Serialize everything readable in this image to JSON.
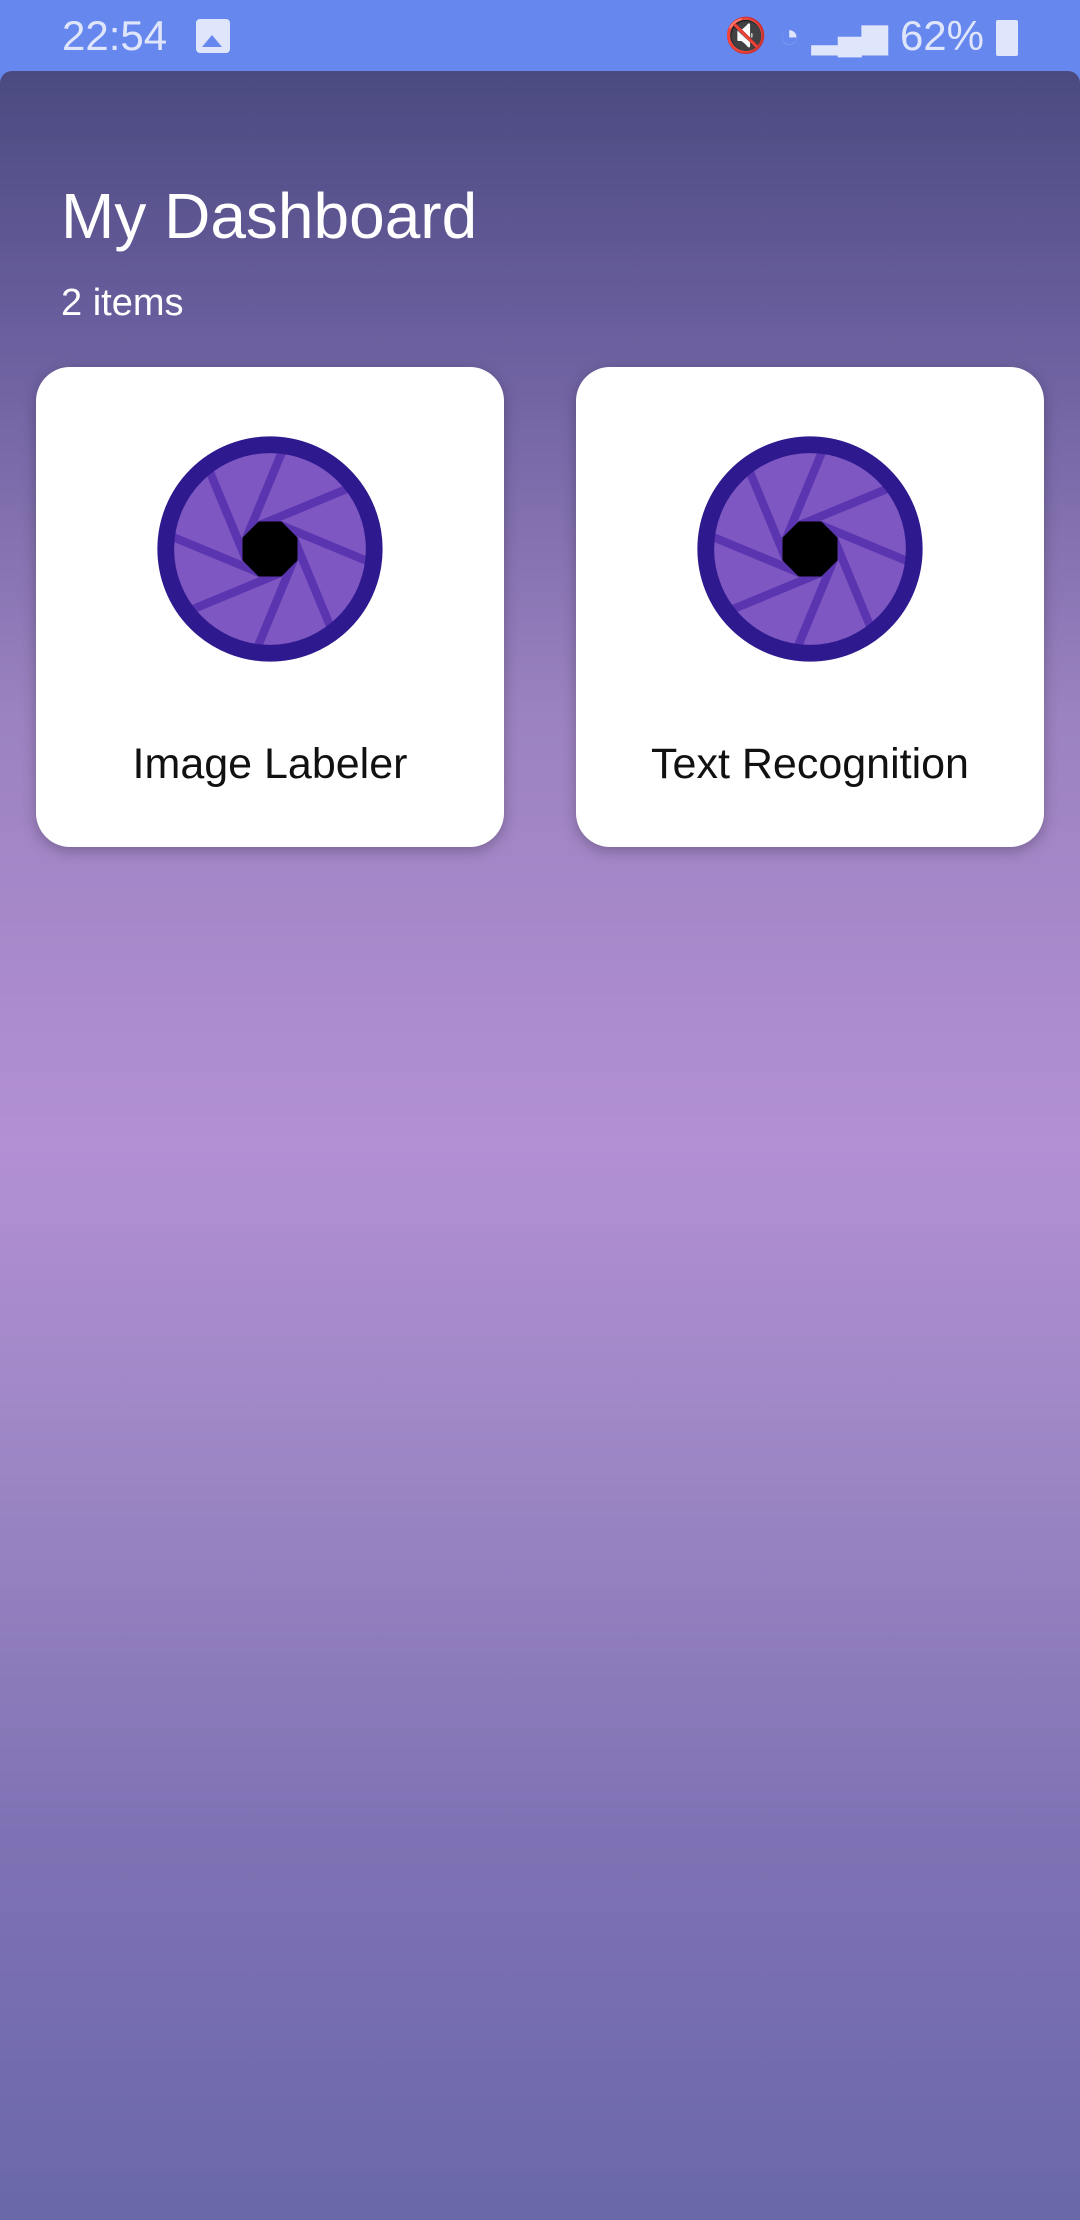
{
  "status_bar": {
    "time": "22:54",
    "battery": "62%",
    "icons": [
      "gallery-icon",
      "vibrate-icon",
      "wifi-icon",
      "signal-icon",
      "battery-icon"
    ]
  },
  "header": {
    "title": "My Dashboard",
    "subtitle": "2 items"
  },
  "cards": [
    {
      "label": "Image Labeler",
      "icon": "camera-aperture-icon"
    },
    {
      "label": "Text Recognition",
      "icon": "camera-aperture-icon"
    }
  ],
  "colors": {
    "status_bar": "#6687ee",
    "gradient_top": "#4a4a80",
    "gradient_mid": "#b38fd4",
    "gradient_bottom": "#6a68a8",
    "icon_ring": "#2e1a8e",
    "icon_fill": "#7e57c2",
    "icon_blades": "#5b35b0"
  }
}
